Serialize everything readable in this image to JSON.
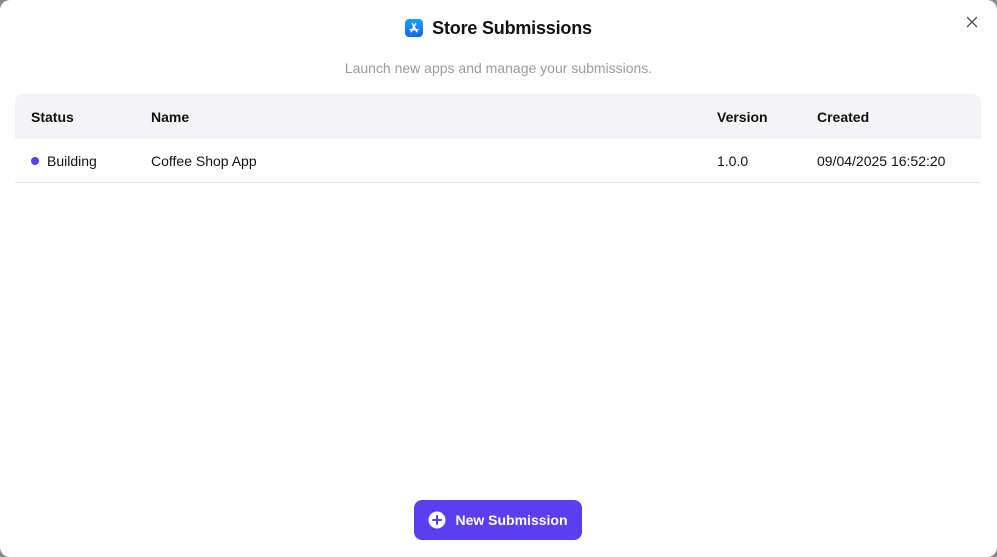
{
  "dialog": {
    "title": "Store Submissions",
    "subtitle": "Launch new apps and manage your submissions.",
    "icons": {
      "app_icon": "app-store-icon",
      "close_icon": "close-icon",
      "plus_icon": "plus-circle-icon"
    }
  },
  "table": {
    "headers": {
      "status": "Status",
      "name": "Name",
      "version": "Version",
      "created": "Created"
    },
    "rows": [
      {
        "status": "Building",
        "name": "Coffee Shop App",
        "version": "1.0.0",
        "created": "09/04/2025 16:52:20"
      }
    ]
  },
  "actions": {
    "new_submission_label": "New Submission"
  },
  "colors": {
    "accent": "#5b3ef0",
    "status_building": "#5b3ef0",
    "app_icon": "#1b7ff5"
  }
}
